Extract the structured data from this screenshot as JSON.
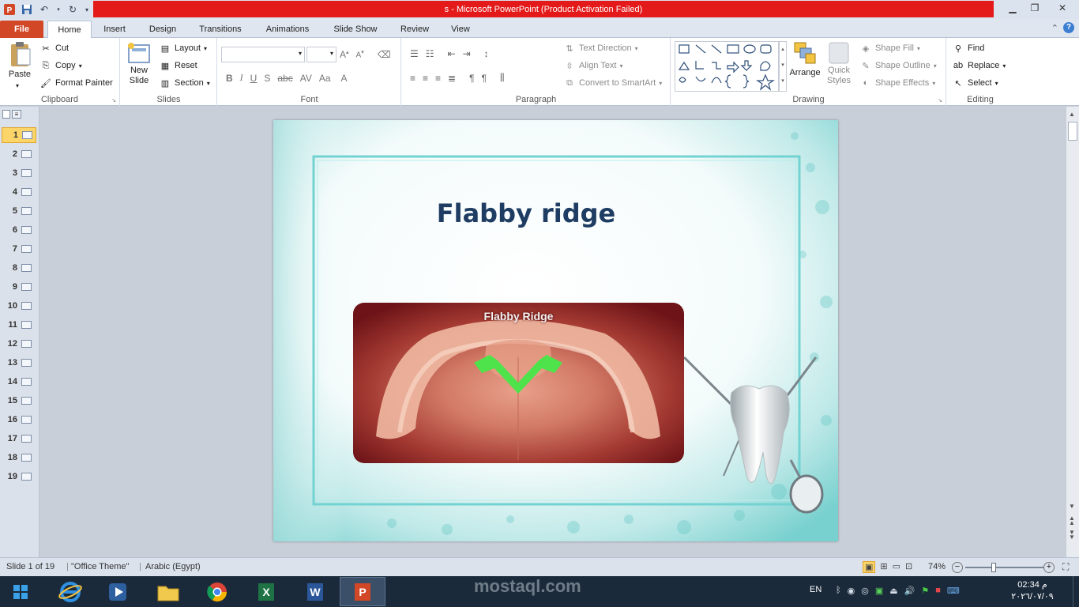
{
  "window": {
    "title": "s  -  Microsoft PowerPoint (Product Activation Failed)",
    "minimize": "▁",
    "restore": "❐",
    "close": "✕"
  },
  "tabs": [
    {
      "label": "File"
    },
    {
      "label": "Home"
    },
    {
      "label": "Insert"
    },
    {
      "label": "Design"
    },
    {
      "label": "Transitions"
    },
    {
      "label": "Animations"
    },
    {
      "label": "Slide Show"
    },
    {
      "label": "Review"
    },
    {
      "label": "View"
    }
  ],
  "ribbon": {
    "clipboard": {
      "label": "Clipboard",
      "paste": "Paste",
      "cut": "Cut",
      "copy": "Copy",
      "format_painter": "Format Painter"
    },
    "slides": {
      "label": "Slides",
      "new_slide_1": "New",
      "new_slide_2": "Slide",
      "layout": "Layout",
      "reset": "Reset",
      "section": "Section"
    },
    "font": {
      "label": "Font"
    },
    "paragraph": {
      "label": "Paragraph",
      "text_direction": "Text Direction",
      "align_text": "Align Text",
      "convert_smartart": "Convert to SmartArt"
    },
    "drawing": {
      "label": "Drawing",
      "arrange": "Arrange",
      "quick_styles_1": "Quick",
      "quick_styles_2": "Styles",
      "shape_fill": "Shape Fill",
      "shape_outline": "Shape Outline",
      "shape_effects": "Shape Effects"
    },
    "editing": {
      "label": "Editing",
      "find": "Find",
      "replace": "Replace",
      "select": "Select"
    }
  },
  "slides_panel": {
    "count": 19,
    "selected": 1,
    "numbers": [
      "1",
      "2",
      "3",
      "4",
      "5",
      "6",
      "7",
      "8",
      "9",
      "10",
      "11",
      "12",
      "13",
      "14",
      "15",
      "16",
      "17",
      "18",
      "19"
    ]
  },
  "slide": {
    "title": "Flabby ridge",
    "image_caption": "Flabby Ridge"
  },
  "status": {
    "slide_info": "Slide 1 of 19",
    "theme": "\"Office Theme\"",
    "language": "Arabic (Egypt)",
    "zoom": "74%",
    "zoom_level": 0.74
  },
  "taskbar": {
    "language": "EN",
    "time": "02:34 م",
    "date": "٢٠٢٦/٠٧/٠٩"
  },
  "watermark": "mostaql.com",
  "colors": {
    "title_red": "#e41a1a",
    "file_tab": "#d24726",
    "slide_title": "#1f3d63",
    "teal": "#6ad0cd"
  }
}
